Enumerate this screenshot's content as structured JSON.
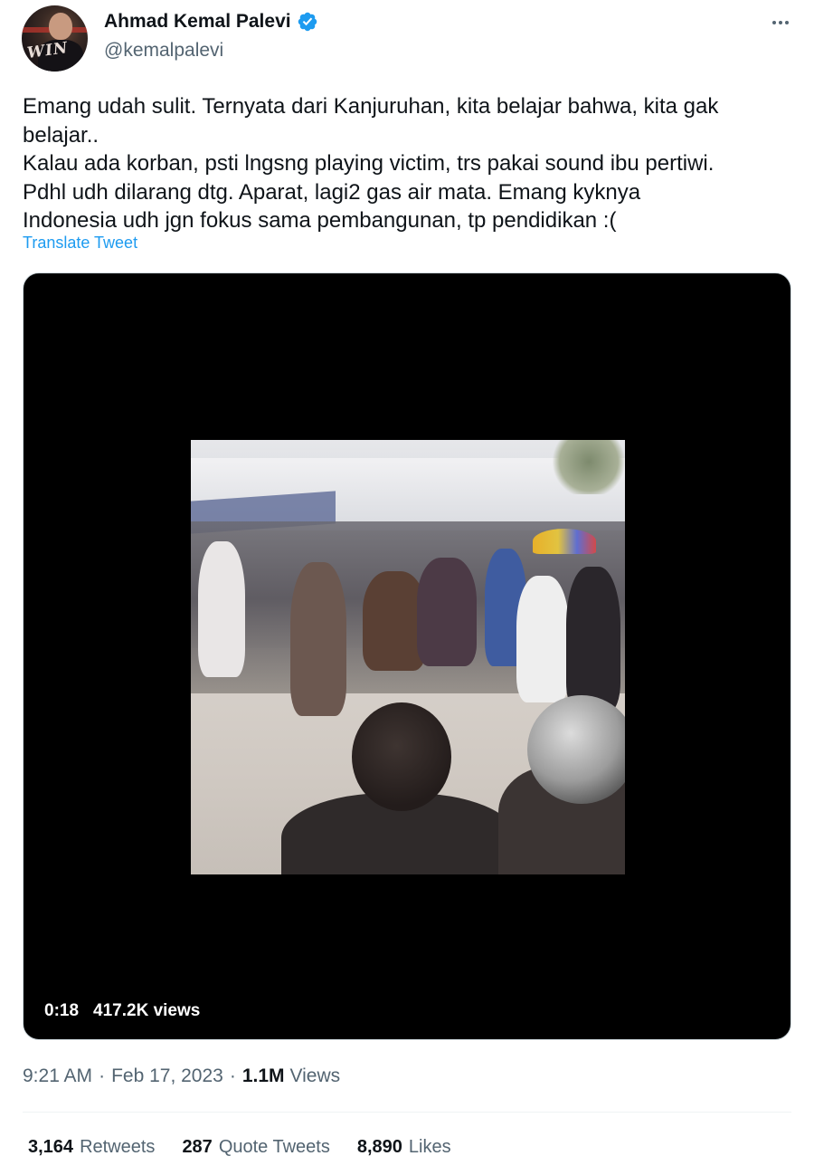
{
  "author": {
    "display_name": "Ahmad Kemal Palevi",
    "handle": "@kemalpalevi",
    "verified": true,
    "avatar_text": "WIN"
  },
  "tweet": {
    "text_lines": [
      "Emang udah sulit. Ternyata dari Kanjuruhan, kita belajar bahwa, kita gak",
      "belajar..",
      "Kalau ada korban, psti lngsng playing victim, trs pakai sound ibu pertiwi.",
      "Pdhl udh dilarang dtg. Aparat, lagi2 gas air mata. Emang kyknya",
      "Indonesia udh jgn fokus sama pembangunan, tp pendidikan :("
    ],
    "translate_label": "Translate Tweet"
  },
  "media": {
    "duration": "0:18",
    "views": "417.2K views"
  },
  "meta": {
    "time": "9:21 AM",
    "separator": "·",
    "date": "Feb 17, 2023",
    "views_count": "1.1M",
    "views_label": "Views"
  },
  "stats": {
    "retweets_count": "3,164",
    "retweets_label": "Retweets",
    "quotes_count": "287",
    "quotes_label": "Quote Tweets",
    "likes_count": "8,890",
    "likes_label": "Likes"
  },
  "colors": {
    "accent": "#1d9bf0",
    "secondary_text": "#536471",
    "primary_text": "#0f1419"
  },
  "icons": {
    "verified": "verified-badge-icon",
    "more": "more-horizontal-icon"
  }
}
